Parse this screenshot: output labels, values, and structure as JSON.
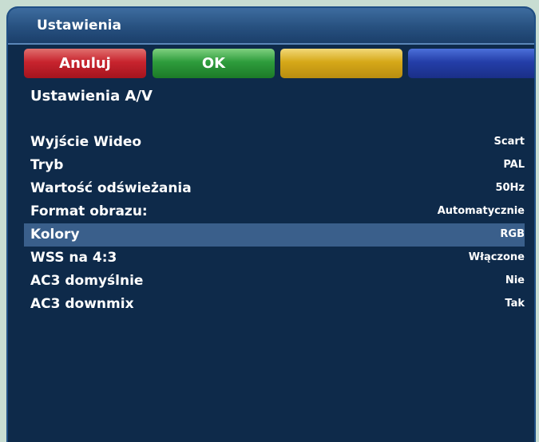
{
  "window": {
    "title": "Ustawienia"
  },
  "buttons": {
    "red": "Anuluj",
    "green": "OK",
    "yellow": "",
    "blue": ""
  },
  "section": {
    "title": "Ustawienia A/V"
  },
  "colors": {
    "panel_background": "#0e2a4a",
    "selected_row": "#3a5f8b",
    "red_button": "#c8242e",
    "green_button": "#2e9c3c",
    "yellow_button": "#d6a818",
    "blue_button": "#243ea8"
  },
  "settings": [
    {
      "label": "Wyjście Wideo",
      "value": "Scart",
      "selected": false
    },
    {
      "label": "Tryb",
      "value": "PAL",
      "selected": false
    },
    {
      "label": "Wartość odświeżania",
      "value": "50Hz",
      "selected": false
    },
    {
      "label": "Format obrazu:",
      "value": "Automatycznie",
      "selected": false
    },
    {
      "label": "Kolory",
      "value": "RGB",
      "selected": true
    },
    {
      "label": "WSS na 4:3",
      "value": "Włączone",
      "selected": false
    },
    {
      "label": "AC3 domyślnie",
      "value": "Nie",
      "selected": false
    },
    {
      "label": "AC3 downmix",
      "value": "Tak",
      "selected": false
    }
  ]
}
